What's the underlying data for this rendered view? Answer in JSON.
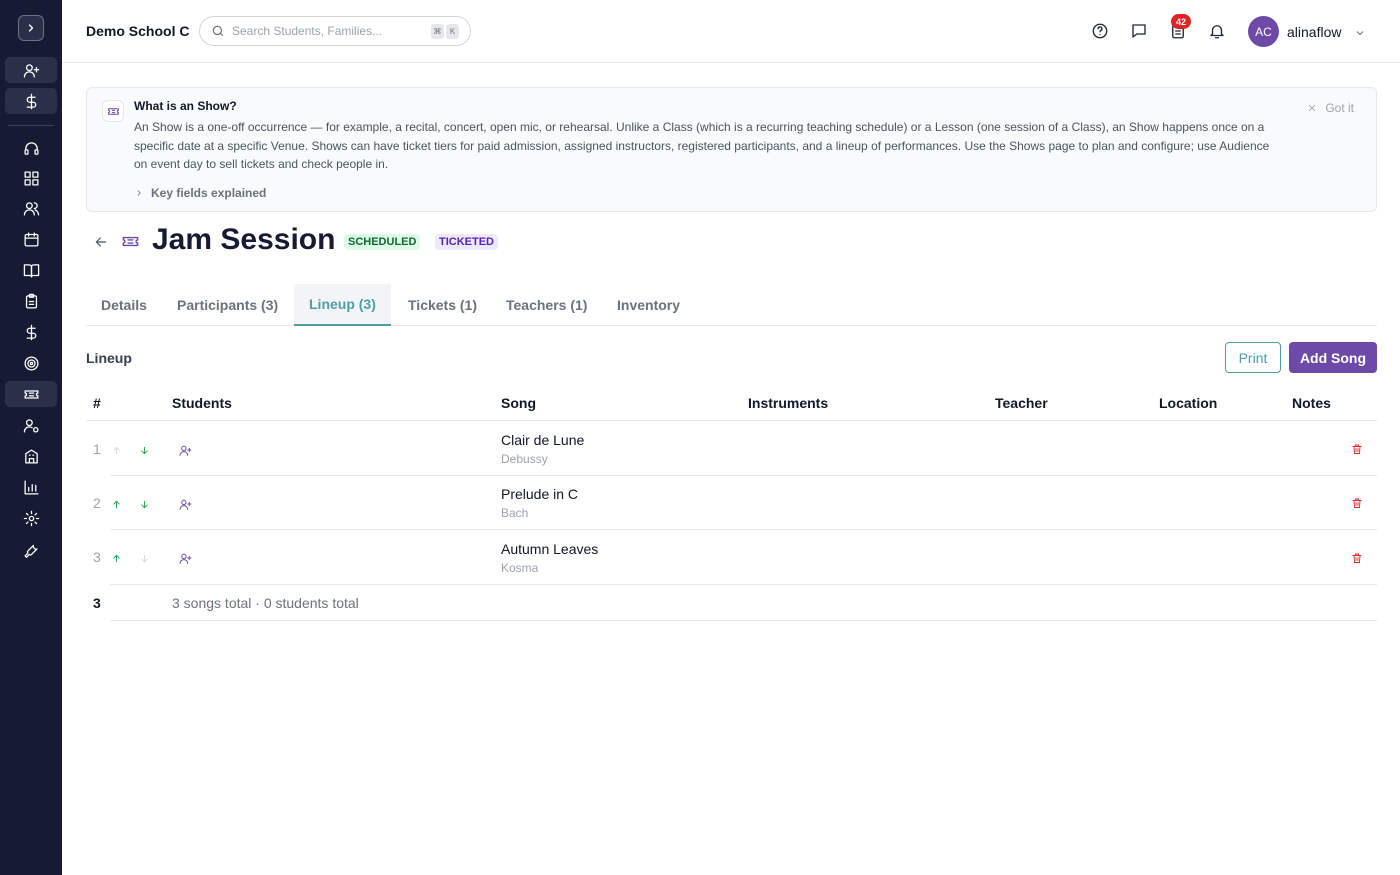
{
  "header": {
    "school": "Demo School C",
    "search_placeholder": "Search Students, Families...",
    "kbd": [
      "⌘",
      "K"
    ],
    "notification_count": "42",
    "avatar_initials": "AC",
    "username": "alinaflow"
  },
  "sidebar": {
    "items": [
      "add-user-icon",
      "dollar-icon",
      "headset-icon",
      "dashboard-icon",
      "users-icon",
      "calendar-icon",
      "book-icon",
      "clipboard-icon",
      "dollar-icon",
      "target-icon",
      "ticket-icon",
      "user-settings-icon",
      "building-icon",
      "chart-icon",
      "gear-icon",
      "wrench-icon"
    ],
    "active": "ticket-icon"
  },
  "info": {
    "title": "What is an Show?",
    "body": "An Show is a one-off occurrence — for example, a recital, concert, open mic, or rehearsal. Unlike a Class (which is a recurring teaching schedule) or a Lesson (one session of a Class), an Show happens once on a specific date at a specific Venue. Shows can have ticket tiers for paid admission, assigned instructors, registered participants, and a lineup of performances. Use the Shows page to plan and configure; use Audience on event day to sell tickets and check people in.",
    "dismiss": "Got it",
    "key_fields": "Key fields explained"
  },
  "page": {
    "title": "Jam Session",
    "status": "SCHEDULED",
    "type": "TICKETED"
  },
  "tabs": [
    {
      "label": "Details"
    },
    {
      "label": "Participants (3)"
    },
    {
      "label": "Lineup (3)"
    },
    {
      "label": "Tickets (1)"
    },
    {
      "label": "Teachers (1)"
    },
    {
      "label": "Inventory"
    }
  ],
  "active_tab": "Lineup (3)",
  "lineup": {
    "title": "Lineup",
    "print_label": "Print",
    "add_label": "Add Song",
    "columns": [
      "#",
      "Students",
      "Song",
      "Instruments",
      "Teacher",
      "Location",
      "Notes"
    ],
    "rows": [
      {
        "num": "1",
        "song": "Clair de Lune",
        "composer": "Debussy",
        "can_up": false,
        "can_down": true
      },
      {
        "num": "2",
        "song": "Prelude in C",
        "composer": "Bach",
        "can_up": true,
        "can_down": true
      },
      {
        "num": "3",
        "song": "Autumn Leaves",
        "composer": "Kosma",
        "can_up": true,
        "can_down": false
      }
    ],
    "total_count": "3",
    "total_text": "3 songs total · 0 students total"
  },
  "colors": {
    "sidebar": "#161b33",
    "accent_teal": "#4f9ea6",
    "accent_purple": "#6d4aa8",
    "success": "#16a34a",
    "danger": "#dc2626"
  }
}
